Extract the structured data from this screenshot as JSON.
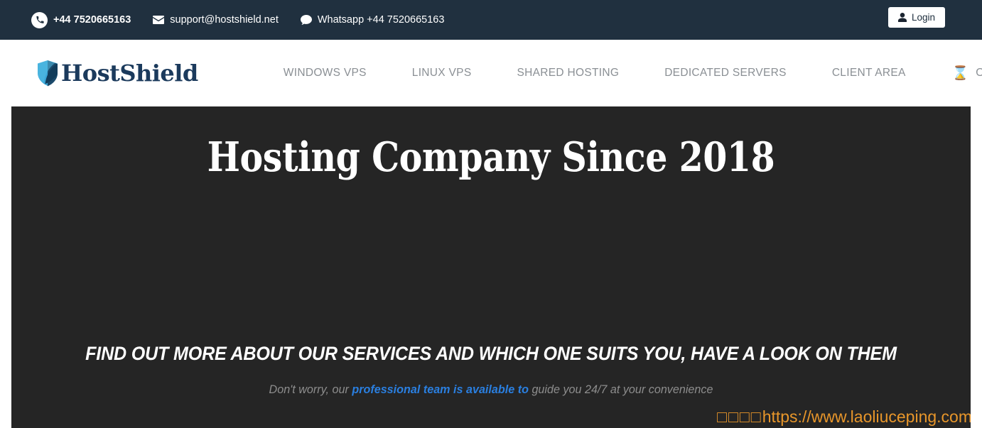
{
  "topbar": {
    "phone": "+44 7520665163",
    "email": "support@hostshield.net",
    "whatsapp": "Whatsapp +44 7520665163",
    "login_label": "Login",
    "background_color": "#20303f"
  },
  "header": {
    "logo_text": "HostShield",
    "logo_color": "#1b3a5c",
    "logo_accent_color": "#3aa6d8",
    "nav": [
      {
        "label": "WINDOWS VPS"
      },
      {
        "label": "LINUX VPS"
      },
      {
        "label": "SHARED HOSTING"
      },
      {
        "label": "DEDICATED SERVERS"
      },
      {
        "label": "CLIENT AREA"
      },
      {
        "label": "OTHER",
        "icon": "hourglass-icon",
        "icon_glyph": "⌛"
      }
    ]
  },
  "hero": {
    "title": "Hosting Company Since 2018",
    "subtitle": "FIND OUT MORE ABOUT OUR SERVICES AND WHICH ONE SUITS YOU, HAVE A LOOK ON THEM",
    "tagline_before": "Don't worry, our ",
    "tagline_link": "professional team is available to",
    "tagline_after": " guide you 24/7 at your convenience",
    "background_color": "#252525",
    "link_color": "#2a7fe0"
  },
  "watermark": {
    "prefix": "□□□□",
    "url": "https://www.laoliuceping.com",
    "color": "#e8962a"
  }
}
